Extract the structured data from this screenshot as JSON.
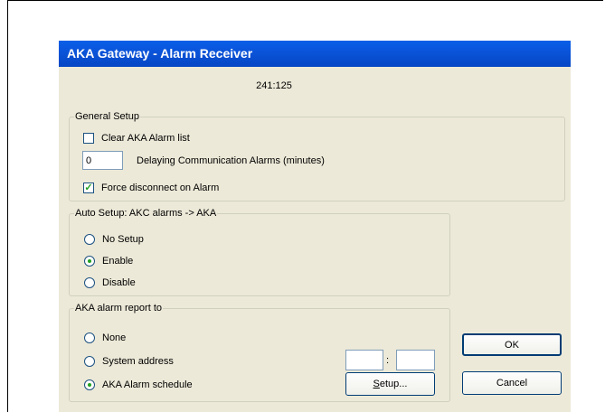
{
  "window": {
    "title": "AKA  Gateway - Alarm Receiver",
    "device_id": "241:125"
  },
  "general_setup": {
    "title": "General Setup",
    "clear_list": {
      "label": "Clear AKA Alarm list",
      "checked": false
    },
    "delay": {
      "value": "0",
      "label": "Delaying Communication Alarms (minutes)"
    },
    "force_disconnect": {
      "label": "Force disconnect on Alarm",
      "checked": true
    }
  },
  "auto_setup": {
    "title": "Auto Setup: AKC alarms -> AKA",
    "options": [
      {
        "label": "No Setup",
        "selected": false
      },
      {
        "label": "Enable",
        "selected": true
      },
      {
        "label": "Disable",
        "selected": false
      }
    ]
  },
  "report_to": {
    "title": "AKA alarm report to",
    "options": [
      {
        "label": "None",
        "selected": false
      },
      {
        "label": "System address",
        "selected": false
      },
      {
        "label": "AKA Alarm schedule",
        "selected": true
      }
    ],
    "address_separator": ":",
    "address_left": "",
    "address_right": "",
    "setup_button": {
      "prefix": "S",
      "rest": "etup..."
    }
  },
  "buttons": {
    "ok": "OK",
    "cancel": "Cancel"
  }
}
